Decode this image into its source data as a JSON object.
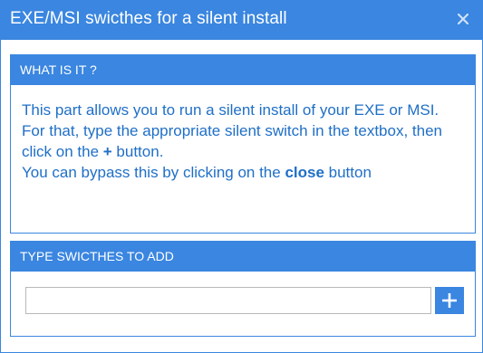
{
  "window": {
    "title": "EXE/MSI swicthes for a silent install"
  },
  "info_panel": {
    "header": "WHAT IS IT ?",
    "line1": "This part allows you to run a silent install of your EXE or MSI.",
    "line2_pre": "For that, type the appropriate silent switch in the textbox, then click on the ",
    "line2_plus": "+",
    "line2_post": " button.",
    "line3_pre": "You can bypass this by clicking on the ",
    "line3_bold": "close",
    "line3_post": " button"
  },
  "switch_panel": {
    "header": "TYPE SWICTHES TO ADD",
    "input_value": "",
    "input_placeholder": ""
  },
  "icons": {
    "close": "close-icon",
    "add": "plus-icon"
  },
  "colors": {
    "accent": "#3a86e0",
    "text_accent": "#1f6fc7"
  }
}
